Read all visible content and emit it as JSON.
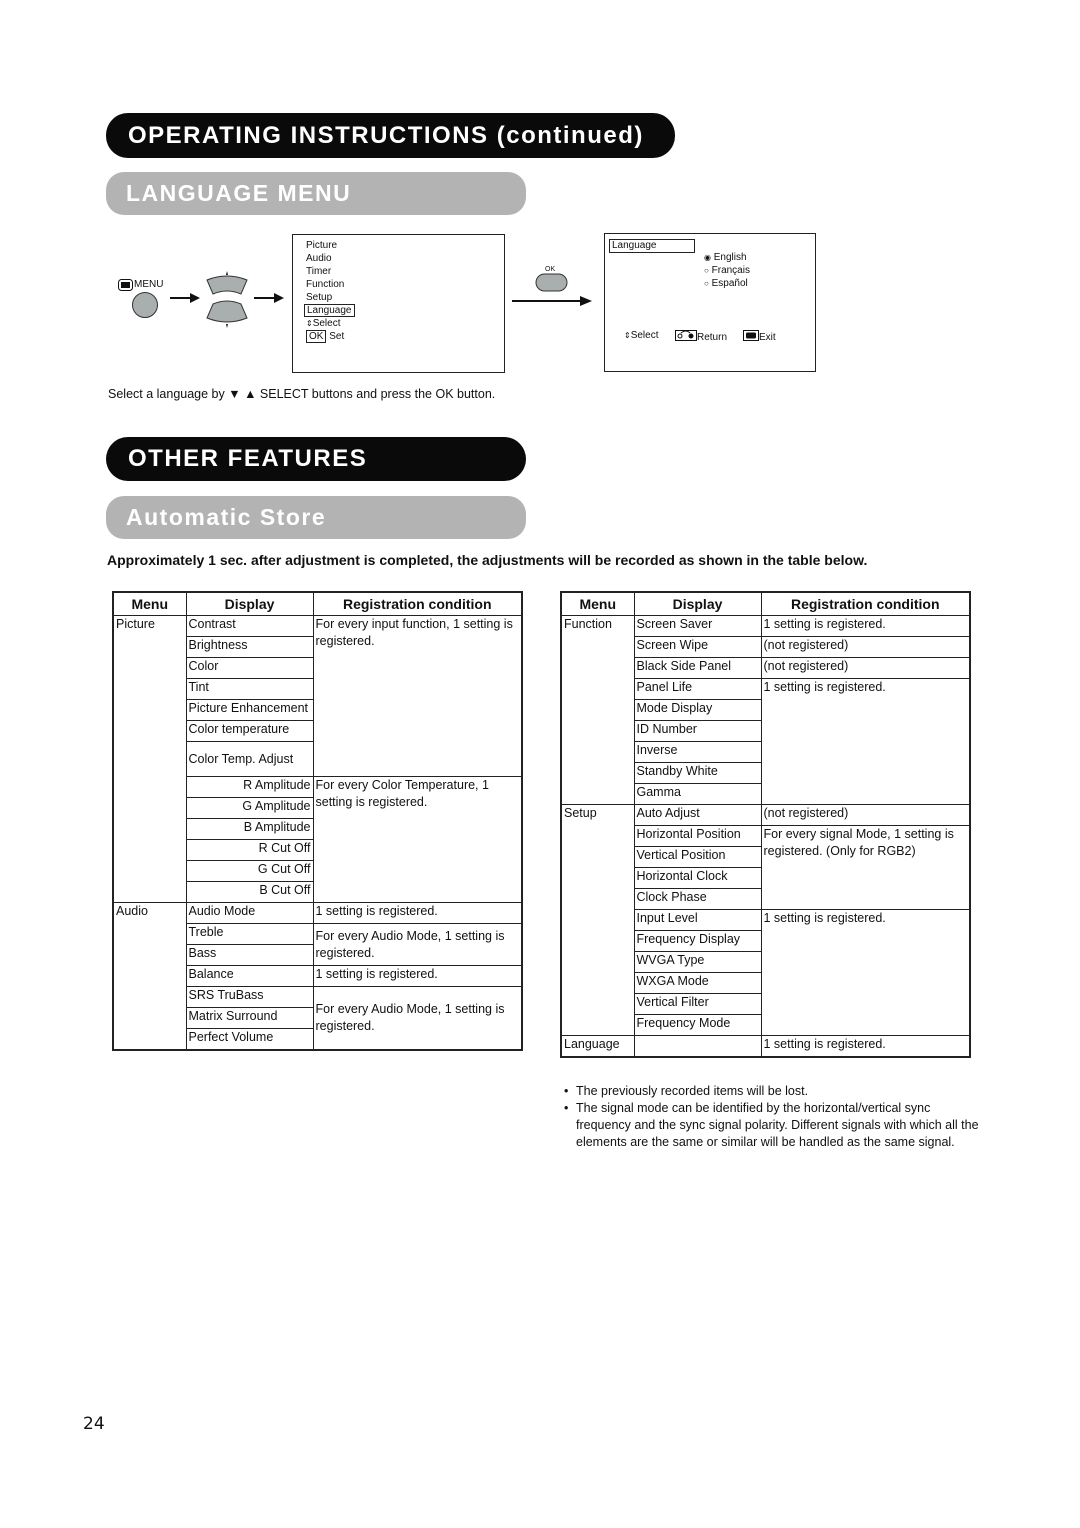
{
  "header": {
    "section_title": "OPERATING INSTRUCTIONS (continued)",
    "subsection_title": "LANGUAGE MENU"
  },
  "language_diagram": {
    "menu_button_label": "MENU",
    "ok_button_label": "OK",
    "main_menu": {
      "items": [
        "Picture",
        "Audio",
        "Timer",
        "Function",
        "Setup",
        "Language"
      ],
      "selected": "Language",
      "hint_select": "Select",
      "hint_ok_key": "OK",
      "hint_set": "Set"
    },
    "language_menu": {
      "title": "Language",
      "options": [
        {
          "label": "English",
          "selected": true
        },
        {
          "label": "Français",
          "selected": false
        },
        {
          "label": "Español",
          "selected": false
        }
      ],
      "hint_select": "Select",
      "hint_return": "Return",
      "hint_exit": "Exit"
    },
    "caption": "Select a language by ▼ ▲ SELECT buttons and press the OK button."
  },
  "other_features": {
    "section_title": "OTHER FEATURES",
    "subsection_title": "Automatic Store",
    "intro": "Approximately 1 sec. after adjustment is completed, the adjustments will be recorded as shown in the table below."
  },
  "table_headers": {
    "menu": "Menu",
    "display": "Display",
    "condition": "Registration condition"
  },
  "left_table": {
    "picture_menu": "Picture",
    "picture_rows": [
      "Contrast",
      "Brightness",
      "Color",
      "Tint",
      "Picture Enhancement",
      "Color temperature",
      "Color Temp. Adjust"
    ],
    "picture_cond": "For every input function, 1 setting is registered.",
    "colortemp_rows": [
      "R Amplitude",
      "G Amplitude",
      "B Amplitude",
      "R Cut Off",
      "G Cut Off",
      "B Cut Off"
    ],
    "colortemp_cond": "For every Color Temperature, 1 setting is registered.",
    "audio_menu": "Audio",
    "audio_mode": "Audio Mode",
    "audio_mode_cond": "1 setting is registered.",
    "treble": "Treble",
    "bass": "Bass",
    "treble_bass_cond": "For every Audio Mode, 1 setting is registered.",
    "balance": "Balance",
    "balance_cond": "1 setting is registered.",
    "srs": "SRS TruBass",
    "matrix": "Matrix Surround",
    "perfect": "Perfect Volume",
    "srs_cond": "For every Audio Mode, 1 setting is registered."
  },
  "right_table": {
    "function_menu": "Function",
    "screen_saver": "Screen Saver",
    "screen_saver_cond": "1 setting is registered.",
    "screen_wipe": "Screen Wipe",
    "screen_wipe_cond": "(not registered)",
    "black_side": "Black Side Panel",
    "black_side_cond": "(not registered)",
    "func_rows": [
      "Panel Life",
      "Mode Display",
      "ID Number",
      "Inverse",
      "Standby White",
      "Gamma"
    ],
    "func_cond": "1 setting is registered.",
    "setup_menu": "Setup",
    "auto_adjust": "Auto Adjust",
    "auto_adjust_cond": "(not registered)",
    "pos_rows": [
      "Horizontal Position",
      "Vertical Position",
      "Horizontal Clock",
      "Clock Phase"
    ],
    "pos_cond": "For every signal Mode, 1 setting is registered. (Only for RGB2)",
    "level_rows": [
      "Input Level",
      "Frequency Display",
      "WVGA Type",
      "WXGA Mode",
      "Vertical Filter",
      "Frequency Mode"
    ],
    "level_cond": "1 setting is registered.",
    "language_menu": "Language",
    "language_cond": "1 setting is registered."
  },
  "notes": [
    "The previously recorded items will be lost.",
    "The signal mode can be identified by the horizontal/vertical sync frequency and the sync signal polarity. Different signals with which all the elements are the same or similar will be handled as the same signal."
  ],
  "page_number": "24"
}
